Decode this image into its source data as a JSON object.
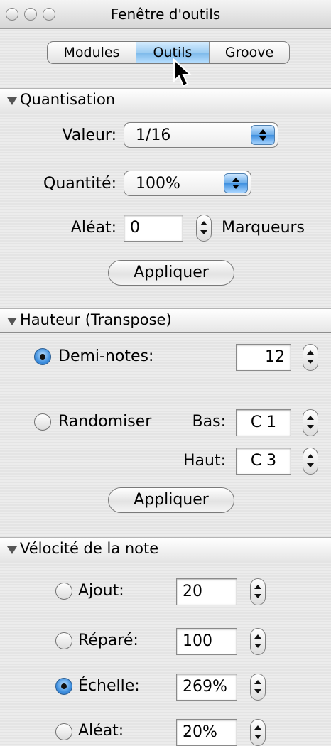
{
  "window": {
    "title": "Fenêtre d'outils"
  },
  "tabs": [
    {
      "label": "Modules",
      "active": false
    },
    {
      "label": "Outils",
      "active": true
    },
    {
      "label": "Groove",
      "active": false
    }
  ],
  "quantisation": {
    "header": "Quantisation",
    "valeur_label": "Valeur:",
    "valeur_value": "1/16",
    "quantite_label": "Quantité:",
    "quantite_value": "100%",
    "aleat_label": "Aléat:",
    "aleat_value": "0",
    "marqueurs_label": "Marqueurs",
    "apply_label": "Appliquer"
  },
  "hauteur": {
    "header": "Hauteur (Transpose)",
    "demi_notes_label": "Demi-notes:",
    "demi_notes_value": "12",
    "demi_notes_selected": true,
    "randomiser_label": "Randomiser",
    "randomiser_selected": false,
    "bas_label": "Bas:",
    "bas_value": "C 1",
    "haut_label": "Haut:",
    "haut_value": "C 3",
    "apply_label": "Appliquer"
  },
  "velocite": {
    "header": "Vélocité de la note",
    "ajout_label": "Ajout:",
    "ajout_value": "20",
    "ajout_selected": false,
    "repare_label": "Réparé:",
    "repare_value": "100",
    "repare_selected": false,
    "echelle_label": "Échelle:",
    "echelle_value": "269%",
    "echelle_selected": true,
    "aleat_label": "Aléat:",
    "aleat_value": "20%",
    "aleat_selected": false
  },
  "colors": {
    "accent": "#3e8fdf",
    "window_bg": "#e8e8e8"
  }
}
